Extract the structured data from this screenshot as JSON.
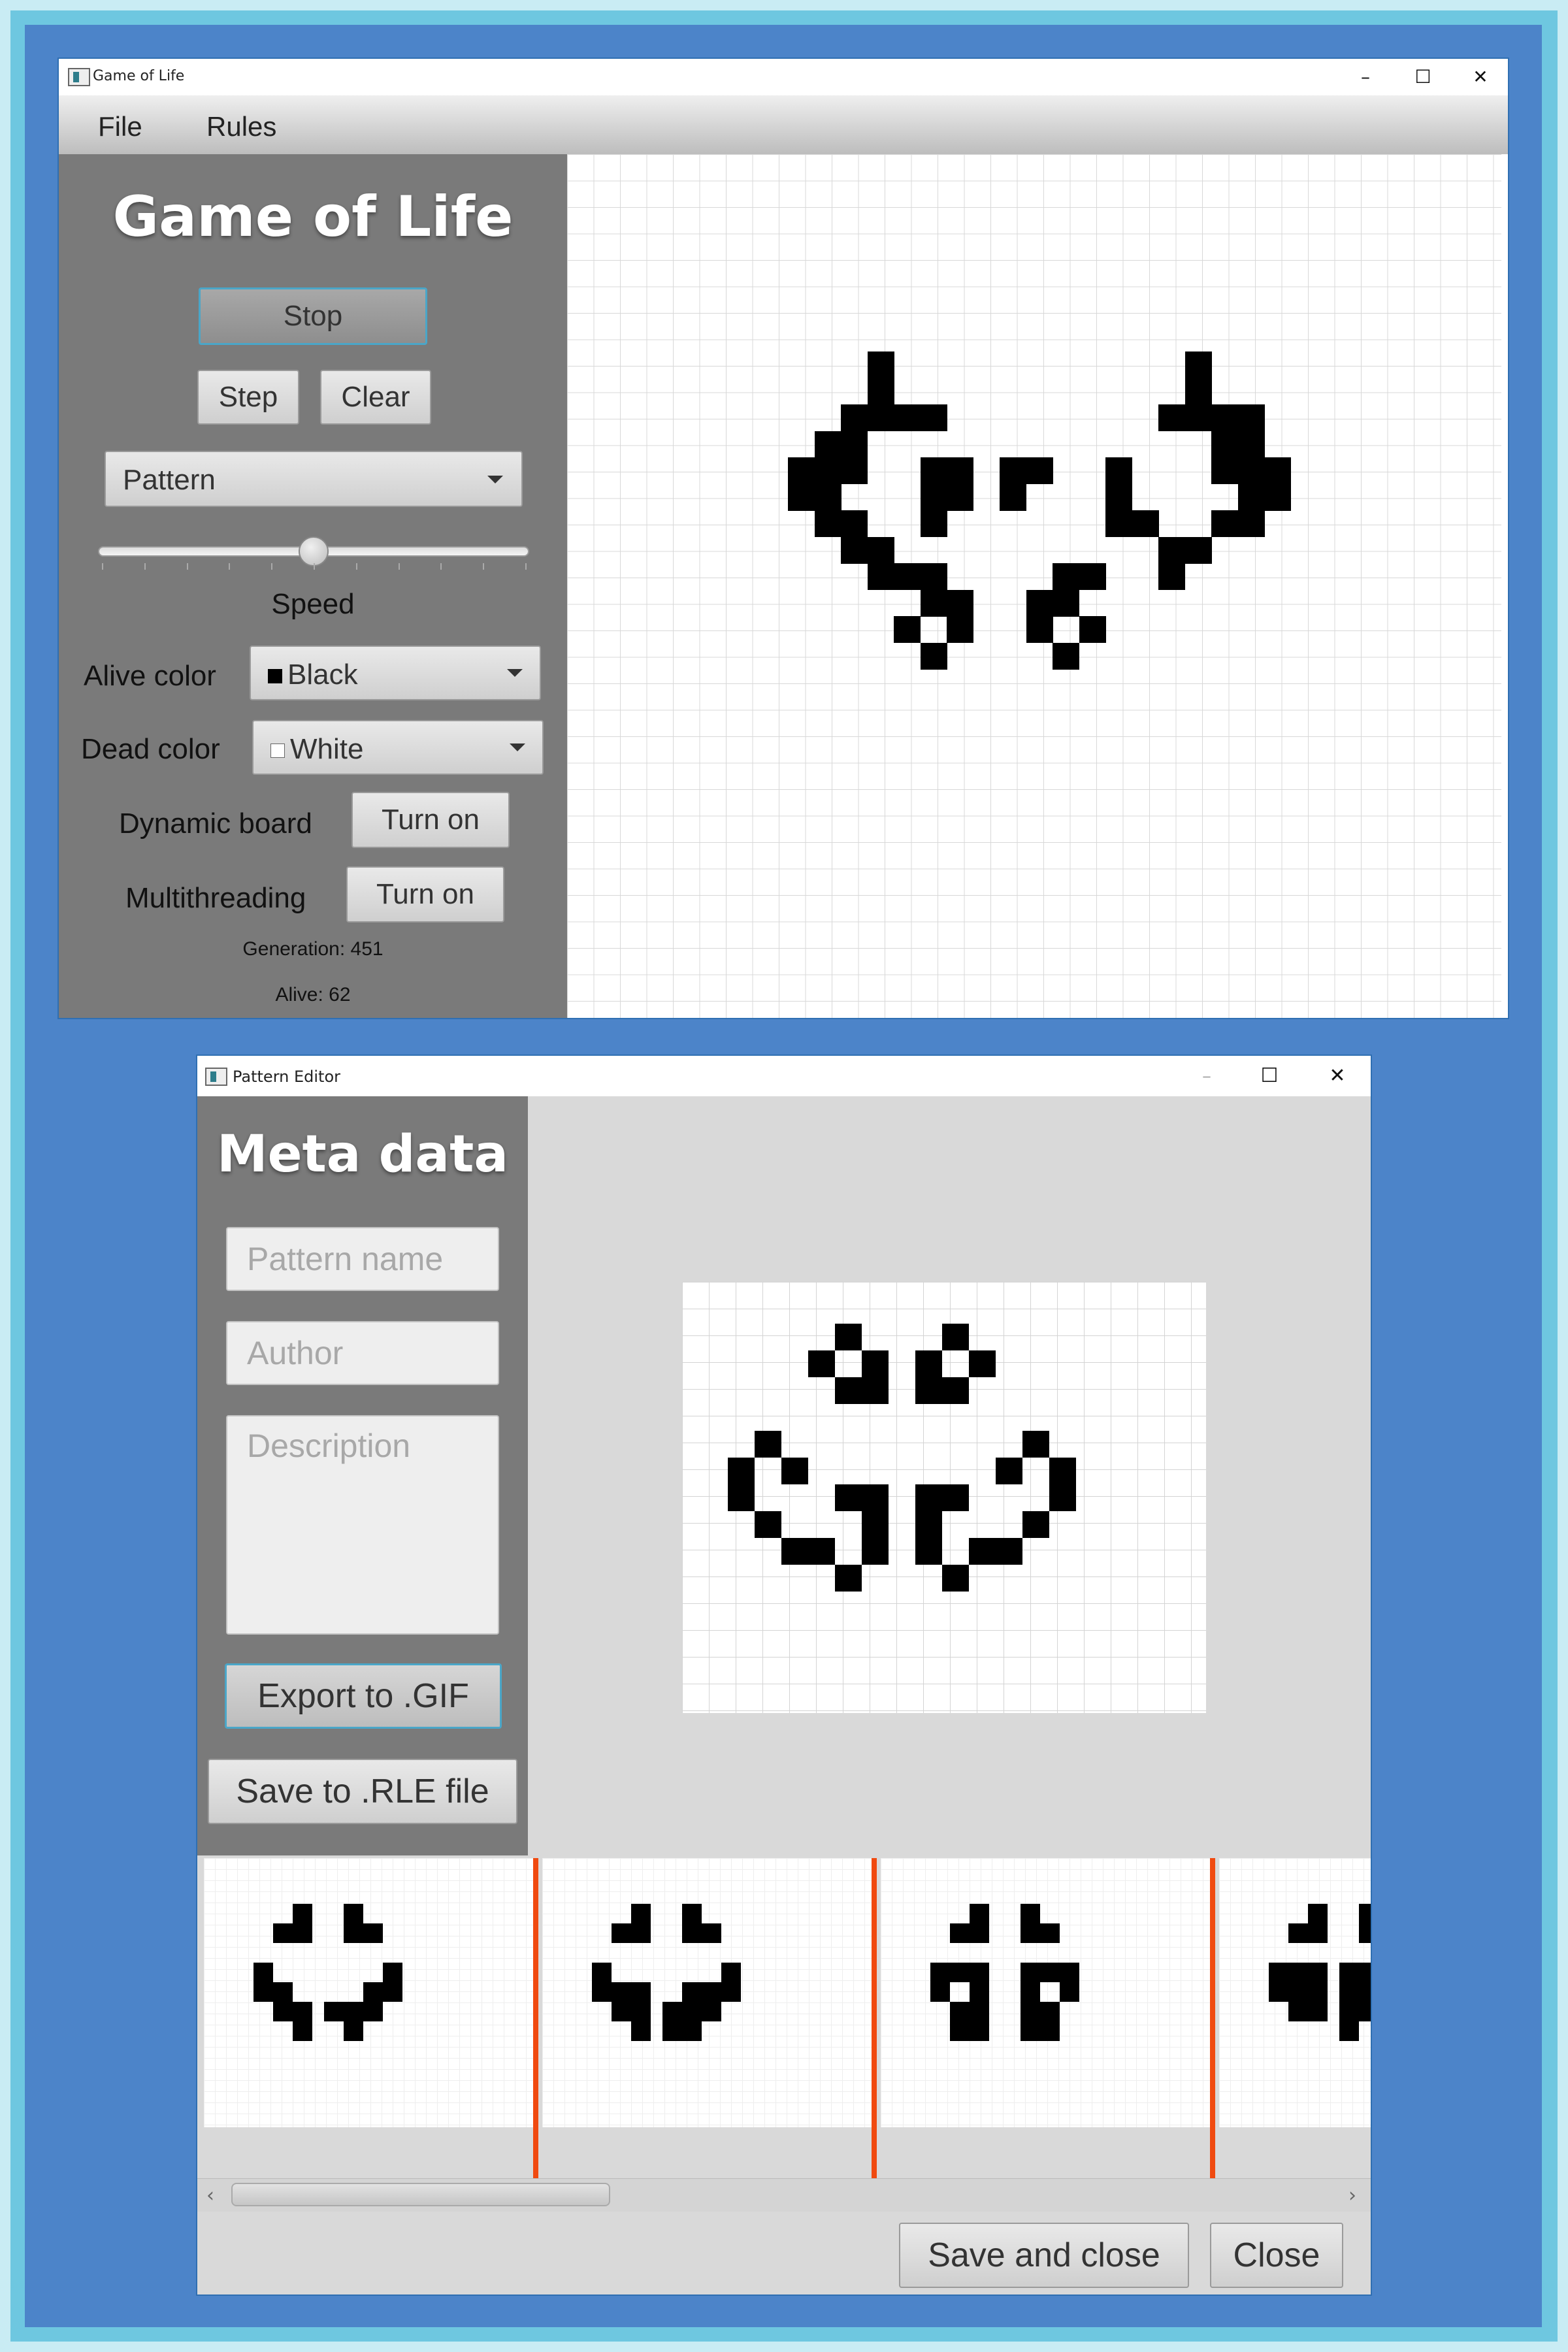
{
  "main_window": {
    "title": "Game of Life",
    "window_buttons": {
      "minimize": "–",
      "maximize": "☐",
      "close": "✕"
    },
    "menu": [
      "File",
      "Rules"
    ],
    "heading": "Game of Life",
    "stop_label": "Stop",
    "step_label": "Step",
    "clear_label": "Clear",
    "pattern_combo": "Pattern",
    "speed_label": "Speed",
    "speed_value": 0.5,
    "alive_color_label": "Alive color",
    "alive_color_value": "Black",
    "dead_color_label": "Dead color",
    "dead_color_value": "White",
    "dynamic_board_label": "Dynamic board",
    "dynamic_board_button": "Turn on",
    "multithreading_label": "Multithreading",
    "multithreading_button": "Turn on",
    "generation_text": "Generation: 451",
    "alive_text": "Alive: 62",
    "colors": {
      "panel": "#7a7a7a",
      "alive": "#000000",
      "dead": "#ffffff",
      "grid": "#d8d8d8"
    },
    "board_cells": [
      [
        7,
        3
      ],
      [
        7,
        4
      ],
      [
        8,
        0
      ],
      [
        9,
        0
      ],
      [
        9,
        1
      ],
      [
        9,
        2
      ],
      [
        9,
        3
      ],
      [
        11,
        0
      ],
      [
        11,
        1
      ],
      [
        11,
        2
      ],
      [
        11,
        3
      ],
      [
        12,
        3
      ],
      [
        13,
        0
      ],
      [
        13,
        1
      ],
      [
        14,
        0
      ],
      [
        14,
        4
      ],
      [
        15,
        2
      ],
      [
        15,
        3
      ],
      [
        15,
        4
      ],
      [
        16,
        2
      ],
      [
        16,
        3
      ],
      [
        16,
        4
      ],
      [
        17,
        0
      ],
      [
        17,
        1
      ],
      [
        17,
        2
      ],
      [
        17,
        3
      ],
      [
        18,
        0
      ],
      [
        18,
        1
      ],
      [
        18,
        3
      ],
      [
        19,
        1
      ],
      [
        20,
        0
      ],
      [
        21,
        0
      ],
      [
        21,
        1
      ],
      [
        21,
        3
      ],
      [
        22,
        0
      ],
      [
        22,
        1
      ],
      [
        22,
        2
      ],
      [
        22,
        3
      ],
      [
        23,
        0
      ],
      [
        23,
        1
      ],
      [
        23,
        2
      ],
      [
        23,
        3
      ],
      [
        24,
        0
      ],
      [
        24,
        1
      ],
      [
        24,
        2
      ],
      [
        24,
        3
      ],
      [
        25,
        1
      ],
      [
        25,
        2
      ],
      [
        26,
        0
      ],
      [
        26,
        1
      ],
      [
        27,
        0
      ],
      [
        27,
        1
      ],
      [
        28,
        2
      ],
      [
        29,
        2
      ],
      [
        29,
        3
      ],
      [
        30,
        3
      ],
      [
        31,
        1
      ],
      [
        31,
        2
      ],
      [
        32,
        1
      ],
      [
        32,
        2
      ],
      [
        33,
        0
      ],
      [
        34,
        0
      ]
    ]
  },
  "pattern_editor": {
    "title": "Pattern Editor",
    "window_buttons": {
      "minimize": "–",
      "maximize": "☐",
      "close": "✕"
    },
    "heading": "Meta data",
    "name_placeholder": "Pattern name",
    "author_placeholder": "Author",
    "description_placeholder": "Description",
    "export_gif": "Export to .GIF",
    "save_rle": "Save to .RLE file",
    "save_and_close": "Save and close",
    "close": "Close",
    "colors": {
      "panel": "#7a7a7a",
      "background": "#d9d9d9",
      "separator": "#f04a10"
    },
    "preview_cells": [
      [
        5,
        2
      ],
      [
        6,
        1
      ],
      [
        6,
        2
      ],
      [
        6,
        3
      ],
      [
        7,
        1
      ],
      [
        7,
        2
      ],
      [
        8,
        0
      ],
      [
        8,
        3
      ],
      [
        9,
        0
      ],
      [
        9,
        1
      ],
      [
        9,
        3
      ],
      [
        10,
        1
      ],
      [
        10,
        2
      ],
      [
        10,
        3
      ],
      [
        11,
        0
      ],
      [
        11,
        1
      ],
      [
        11,
        2
      ],
      [
        11,
        3
      ],
      [
        12,
        2
      ],
      [
        13,
        1
      ],
      [
        13,
        2
      ],
      [
        13,
        3
      ],
      [
        14,
        0
      ],
      [
        14,
        3
      ]
    ],
    "thumbnail_count": 4
  }
}
